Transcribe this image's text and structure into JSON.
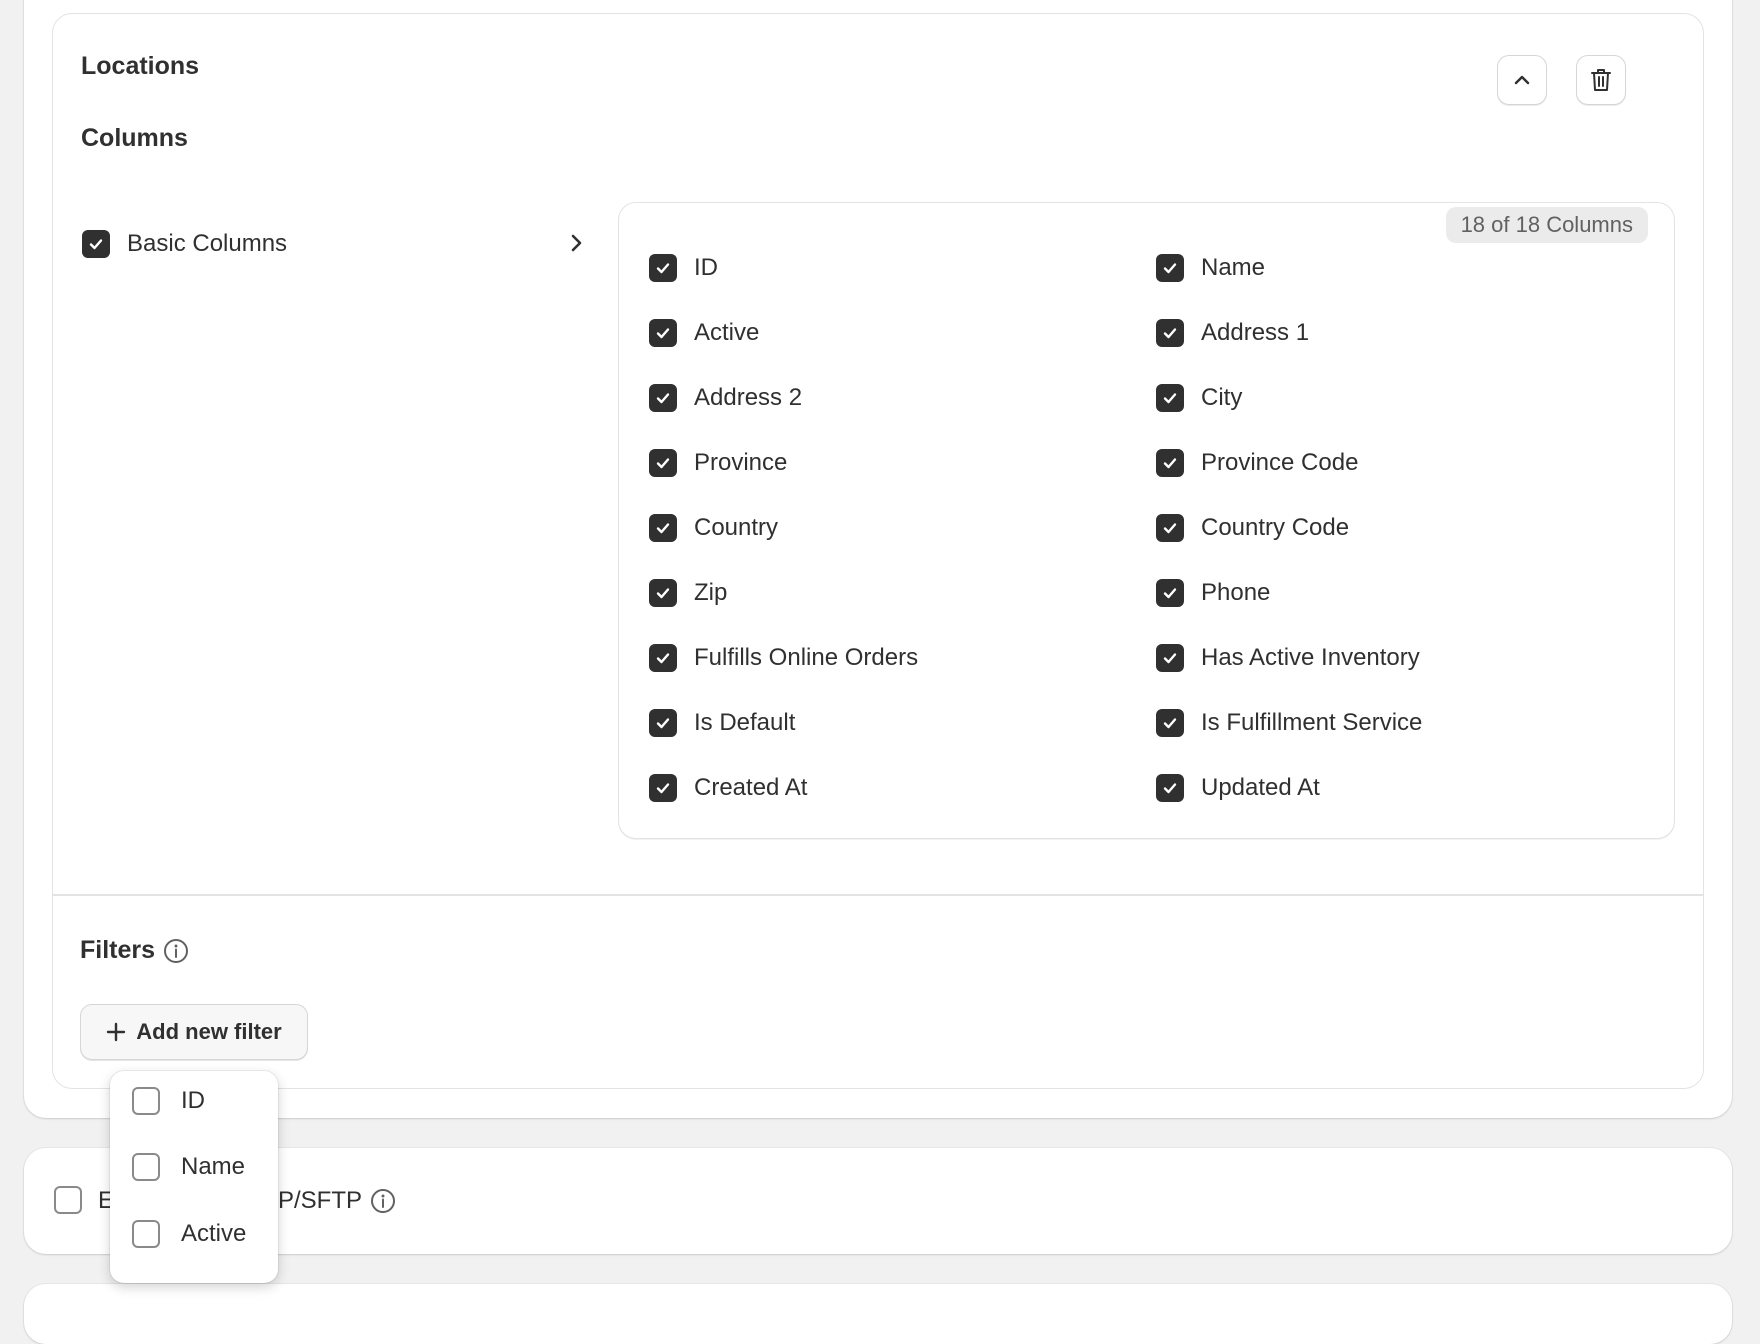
{
  "section": {
    "title": "Locations",
    "columns_heading": "Columns",
    "collapse_icon": "chevron-up-icon",
    "delete_icon": "trash-icon"
  },
  "group": {
    "label": "Basic Columns",
    "checked": true,
    "expand_icon": "chevron-right-icon"
  },
  "columns_panel": {
    "count_badge": "18 of 18 Columns",
    "items": [
      {
        "label": "ID",
        "checked": true
      },
      {
        "label": "Name",
        "checked": true
      },
      {
        "label": "Active",
        "checked": true
      },
      {
        "label": "Address 1",
        "checked": true
      },
      {
        "label": "Address 2",
        "checked": true
      },
      {
        "label": "City",
        "checked": true
      },
      {
        "label": "Province",
        "checked": true
      },
      {
        "label": "Province Code",
        "checked": true
      },
      {
        "label": "Country",
        "checked": true
      },
      {
        "label": "Country Code",
        "checked": true
      },
      {
        "label": "Zip",
        "checked": true
      },
      {
        "label": "Phone",
        "checked": true
      },
      {
        "label": "Fulfills Online Orders",
        "checked": true
      },
      {
        "label": "Has Active Inventory",
        "checked": true
      },
      {
        "label": "Is Default",
        "checked": true
      },
      {
        "label": "Is Fulfillment Service",
        "checked": true
      },
      {
        "label": "Created At",
        "checked": true
      },
      {
        "label": "Updated At",
        "checked": true
      }
    ]
  },
  "filters": {
    "heading": "Filters",
    "info_icon": "info-icon",
    "add_button": "Add new filter",
    "add_icon": "plus-icon"
  },
  "filter_dropdown": {
    "options": [
      {
        "label": "ID",
        "checked": false
      },
      {
        "label": "Name",
        "checked": false
      },
      {
        "label": "Active",
        "checked": false
      }
    ]
  },
  "second_card": {
    "label_left": "E",
    "label_right": "P/SFTP",
    "checked": false,
    "info_icon": "info-icon"
  },
  "colors": {
    "checkbox_checked": "#303030",
    "page_background": "#f1f1f1",
    "badge_background": "#ebebeb"
  }
}
